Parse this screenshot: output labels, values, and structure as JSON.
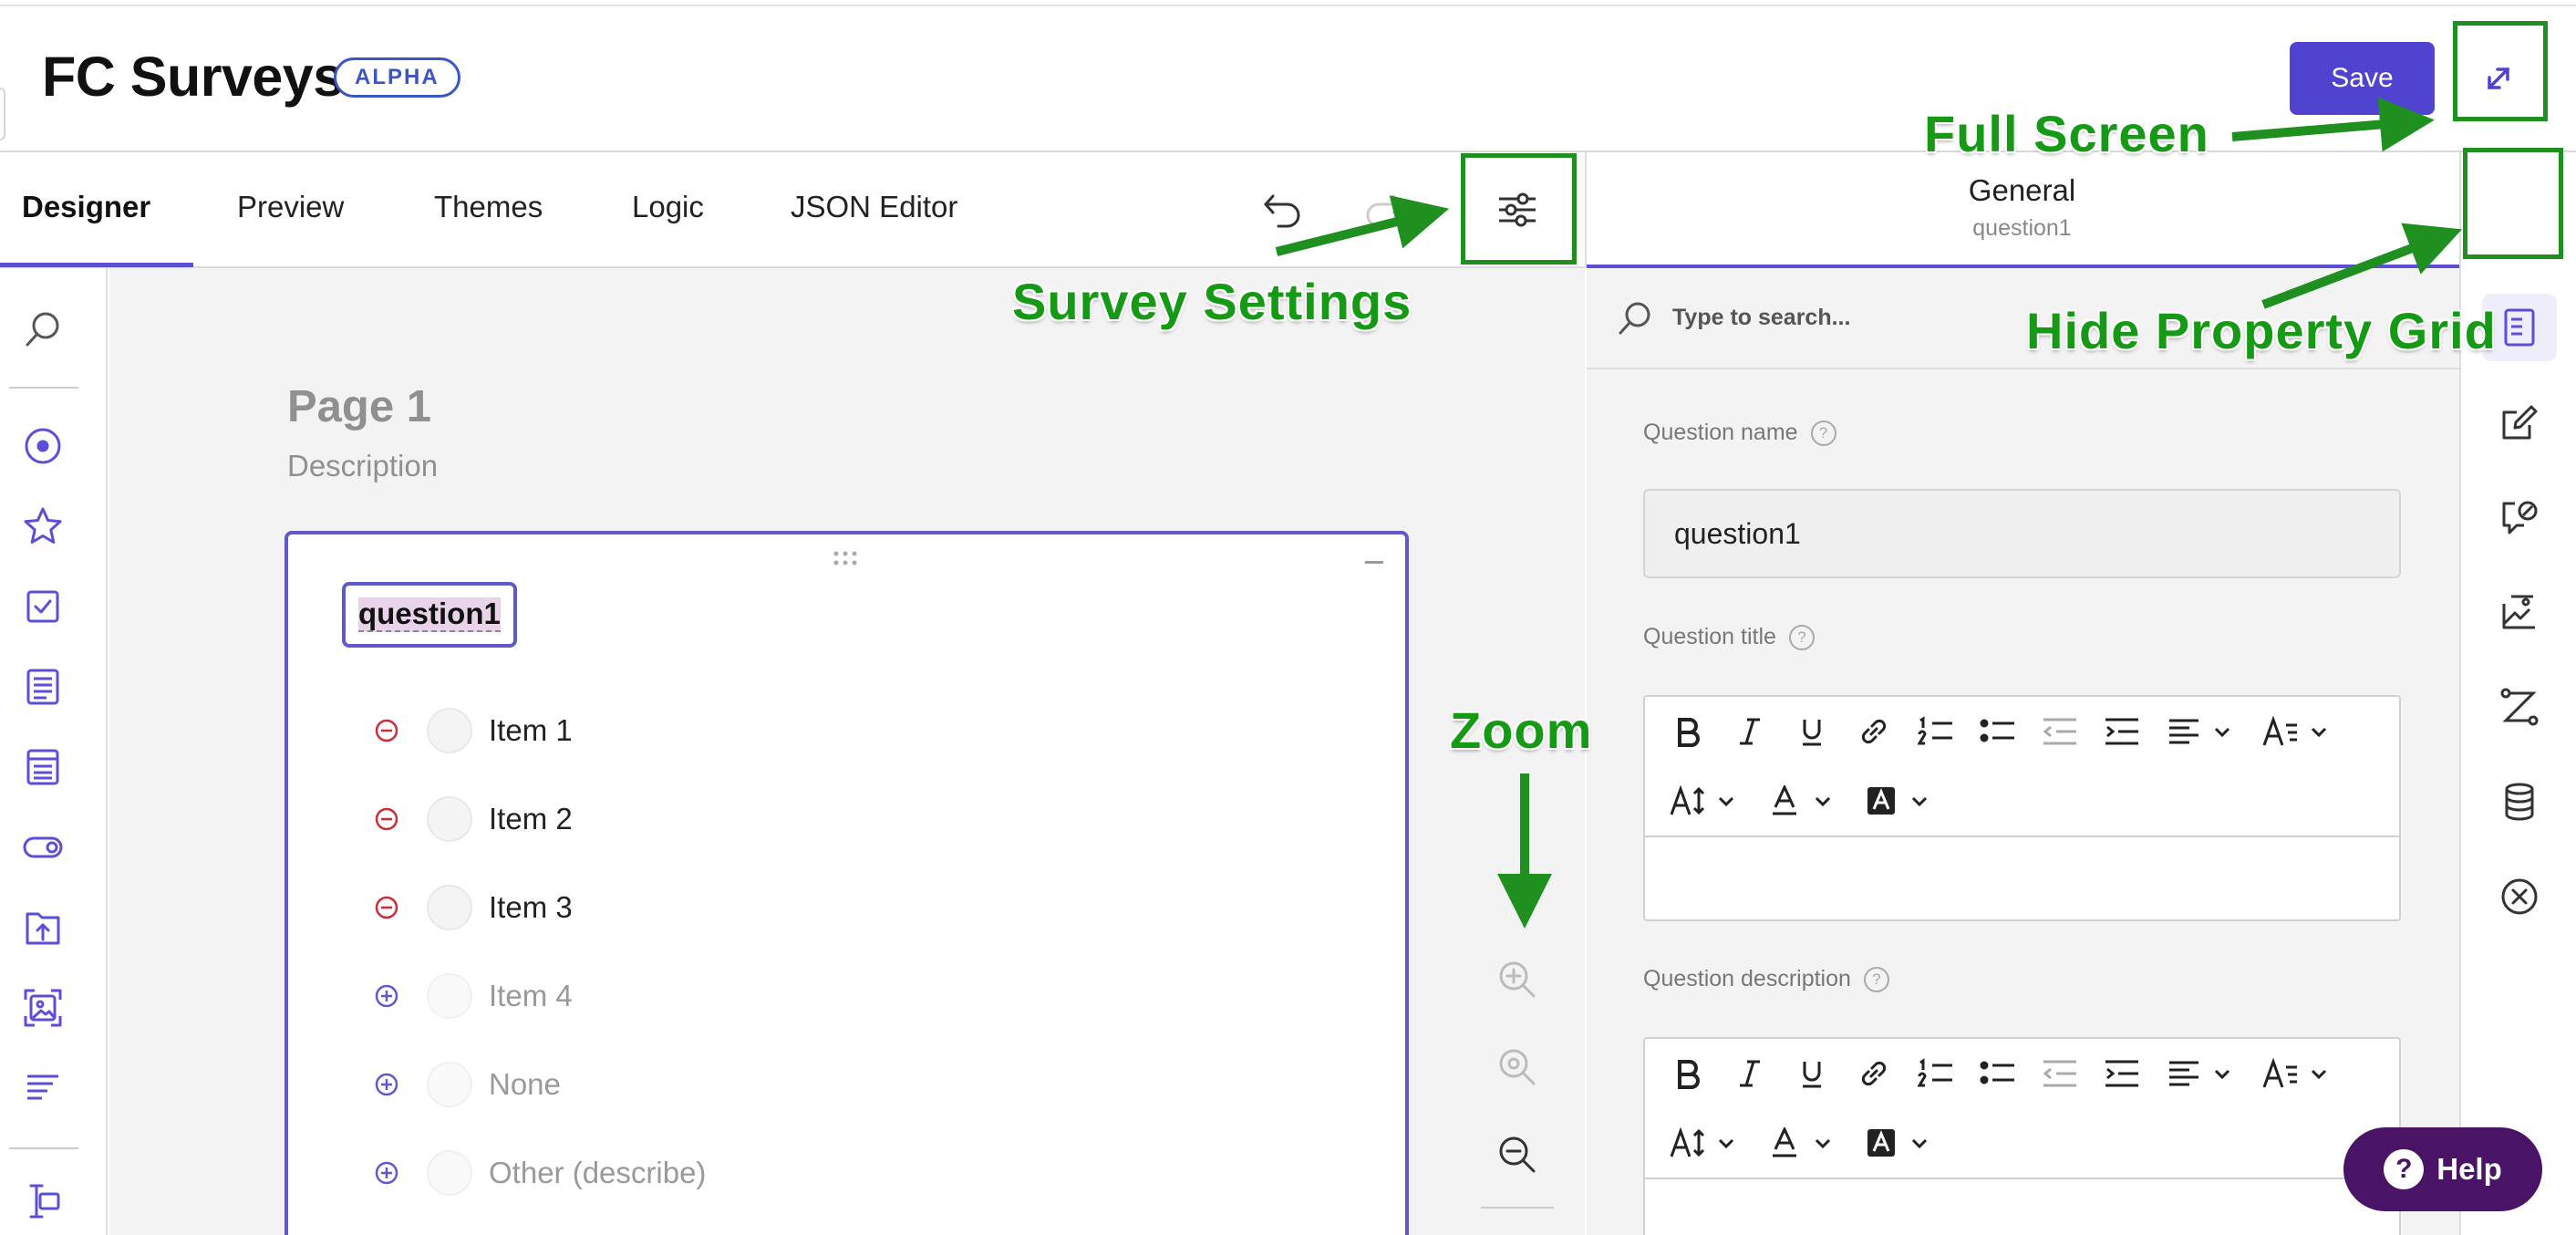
{
  "app": {
    "title": "FC Surveys",
    "badge": "ALPHA",
    "save_label": "Save"
  },
  "tabs": [
    {
      "label": "Designer",
      "active": true
    },
    {
      "label": "Preview"
    },
    {
      "label": "Themes"
    },
    {
      "label": "Logic"
    },
    {
      "label": "JSON Editor"
    }
  ],
  "toolbar_left": {
    "icons": [
      "search-icon",
      "radiogroup-icon",
      "rating-icon",
      "checkbox-icon",
      "dropdown-icon",
      "tagbox-icon",
      "boolean-icon",
      "file-upload-icon",
      "image-picker-icon",
      "ranking-icon",
      "expression-icon"
    ]
  },
  "page": {
    "title": "Page 1",
    "description": "Description"
  },
  "question": {
    "name": "question1",
    "choices": [
      {
        "label": "Item 1",
        "active": true
      },
      {
        "label": "Item 2",
        "active": true
      },
      {
        "label": "Item 3",
        "active": true
      },
      {
        "label": "Item 4",
        "active": false
      },
      {
        "label": "None",
        "active": false
      },
      {
        "label": "Other (describe)",
        "active": false
      }
    ]
  },
  "property_grid": {
    "category": "General",
    "object_name": "question1",
    "search_placeholder": "Type to search...",
    "question_name_label": "Question name",
    "question_name_value": "question1",
    "question_title_label": "Question title",
    "question_description_label": "Question description"
  },
  "help": {
    "label": "Help",
    "symbol": "?"
  },
  "annotations": {
    "full_screen": "Full Screen",
    "survey_settings": "Survey Settings",
    "hide_property_grid": "Hide Property Grid",
    "zoom": "Zoom"
  },
  "colors": {
    "accent": "#5043cf",
    "annotation": "#169a16",
    "help_bg": "#4a1466",
    "remove": "#cc2b3a",
    "add": "#5f59c9"
  }
}
